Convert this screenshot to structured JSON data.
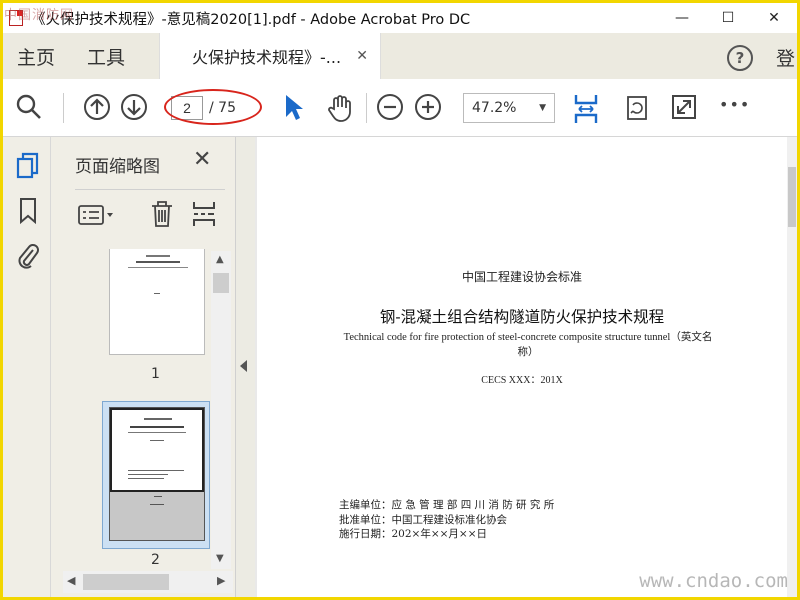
{
  "window": {
    "title": "《火保护技术规程》-意见稿2020[1].pdf - Adobe Acrobat Pro DC",
    "minimize": "—",
    "maximize": "☐",
    "close": "✕",
    "watermark_top": "中国消防网"
  },
  "tabs": {
    "home": "主页",
    "tools": "工具",
    "document": "火保护技术规程》-...",
    "document_close": "✕",
    "help": "?",
    "login": "登"
  },
  "toolbar": {
    "page_current": "2",
    "page_total": "/ 75",
    "zoom": "47.2%",
    "more": "•••",
    "accent_color": "#1b6ac9"
  },
  "thumbnail_panel": {
    "title": "页面缩略图",
    "close": "✕",
    "pages": [
      {
        "label": "1"
      },
      {
        "label": "2",
        "selected": true
      }
    ]
  },
  "document": {
    "org": "中国工程建设协会标准",
    "title": "钢-混凝土组合结构隧道防火保护技术规程",
    "title_en": "Technical code for fire protection of steel-concrete composite structure tunnel（英文名称）",
    "code": "CECS XXX：201X",
    "chief_label": "主编单位：",
    "chief_value": "应 急 管 理 部 四 川 消 防 研 究 所",
    "approve_label": "批准单位：",
    "approve_value": "中国工程建设标准化协会",
    "date_label": "施行日期：",
    "date_value": "202×年××月××日"
  },
  "watermark_bottom": "www.cndao.com"
}
